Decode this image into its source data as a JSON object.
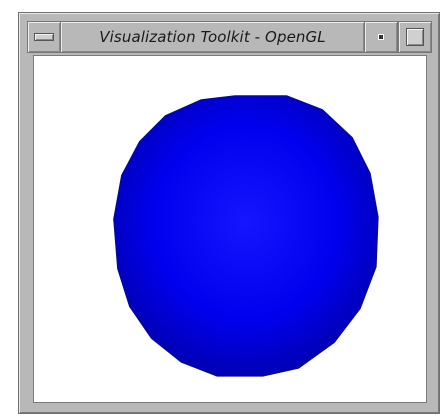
{
  "window": {
    "title": "Visualization Toolkit - OpenGL"
  },
  "titlebar": {
    "menu_icon": "window-menu-icon",
    "minimize_icon": "minimize-icon",
    "maximize_icon": "maximize-icon"
  },
  "scene": {
    "object": "sphere",
    "colors": {
      "background": "#ffffff",
      "sphere_highlight": "#1515ff",
      "sphere_base": "#0000ee",
      "sphere_shadow": "#0000a8"
    }
  }
}
